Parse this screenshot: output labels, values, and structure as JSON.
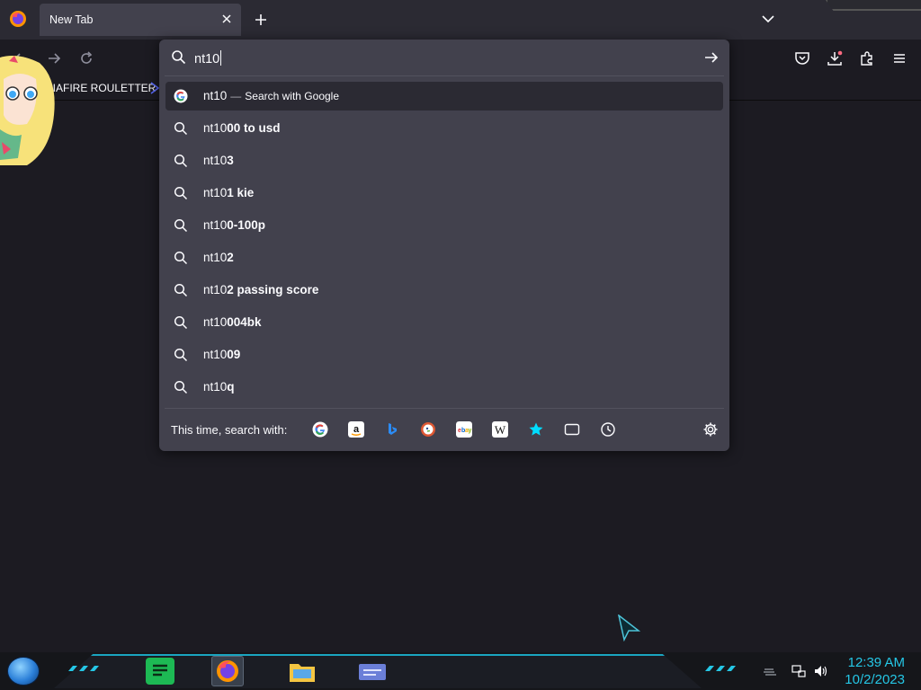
{
  "browser": {
    "tab_title": "New Tab"
  },
  "bookmarks": {
    "item1": "DIAFIRE ROULETTER"
  },
  "urlbar": {
    "typed": "nt10",
    "top_result": {
      "query": "nt10",
      "separator": "—",
      "action": "Search with Google"
    },
    "suggestions": [
      {
        "prefix": "nt10",
        "suffix": "00 to usd"
      },
      {
        "prefix": "nt10",
        "suffix": "3"
      },
      {
        "prefix": "nt10",
        "suffix": "1 kie"
      },
      {
        "prefix": "nt10",
        "suffix": "0-100p"
      },
      {
        "prefix": "nt10",
        "suffix": "2"
      },
      {
        "prefix": "nt10",
        "suffix": "2 passing score"
      },
      {
        "prefix": "nt10",
        "suffix": "004bk"
      },
      {
        "prefix": "nt10",
        "suffix": "09"
      },
      {
        "prefix": "nt10",
        "suffix": "q"
      }
    ],
    "footer_label": "This time, search with:",
    "engines": [
      "google",
      "amazon",
      "bing",
      "duckduckgo",
      "ebay",
      "wikipedia",
      "bookmarks",
      "tabs",
      "history"
    ]
  },
  "taskbar": {
    "time": "12:39 AM",
    "date": "10/2/2023"
  },
  "colors": {
    "panel_bg": "#42414d",
    "selected_row": "#2b2a33",
    "page_bg": "#1c1b22",
    "clock": "#25c7e6"
  }
}
